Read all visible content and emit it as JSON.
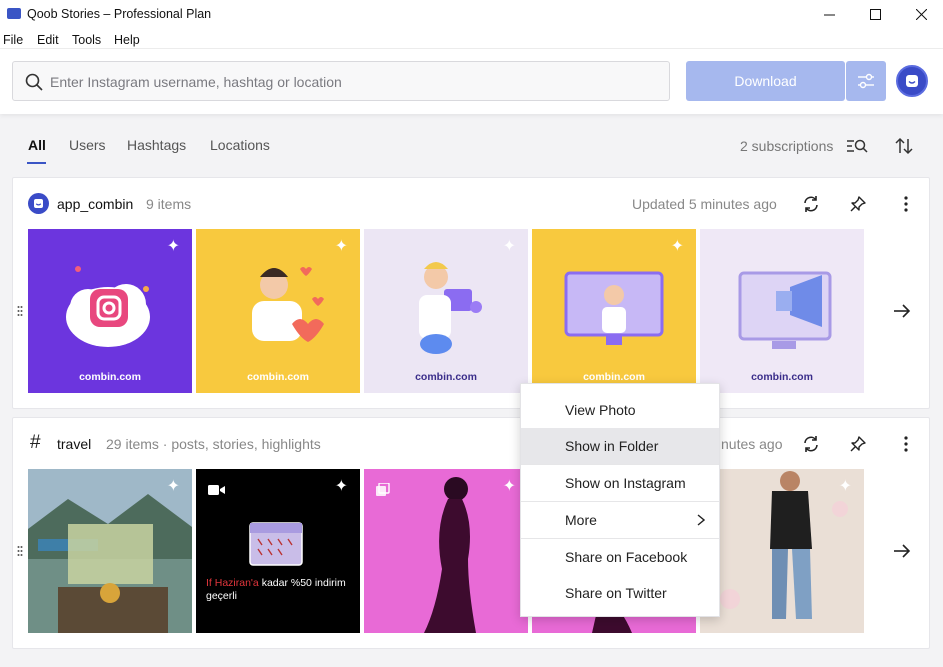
{
  "window": {
    "title": "Qoob Stories – Professional Plan"
  },
  "menu": [
    "File",
    "Edit",
    "Tools",
    "Help"
  ],
  "search": {
    "placeholder": "Enter Instagram username, hashtag or location"
  },
  "toolbar": {
    "download_label": "Download"
  },
  "tabs": [
    "All",
    "Users",
    "Hashtags",
    "Locations"
  ],
  "subscriptions_label": "2 subscriptions",
  "cards": [
    {
      "name": "app_combin",
      "count": "9 items",
      "updated": "Updated 5 minutes ago",
      "thumbs": [
        {
          "brand": "combin.com",
          "bg": "#6c35de"
        },
        {
          "brand": "combin.com",
          "bg": "#f8c93e"
        },
        {
          "brand": "combin.com",
          "bg": "#ece6f4"
        },
        {
          "brand": "combin.com",
          "bg": "#f8c93e"
        },
        {
          "brand": "combin.com",
          "bg": "#efe8f6"
        }
      ]
    },
    {
      "name": "travel",
      "count": "29 items · posts, stories, highlights",
      "updated": "nutes ago",
      "thumbs": [
        {
          "brand": "",
          "bg": "#5a7a6a"
        },
        {
          "brand": "",
          "bg": "#000000",
          "text1": "If Haziran'a",
          "text2": "kadar %50 indirim",
          "text3": "geçerli"
        },
        {
          "brand": "",
          "bg": "#e86ad6"
        },
        {
          "brand": "",
          "bg": "#e86ad6"
        },
        {
          "brand": "",
          "bg": "#e9ddd6"
        }
      ]
    }
  ],
  "context_menu": {
    "items": [
      "View Photo",
      "Show in Folder",
      "Show on Instagram",
      "More",
      "Share on Facebook",
      "Share on Twitter"
    ],
    "highlighted": "Show in Folder"
  },
  "colors": {
    "accent": "#3a55c5",
    "button": "#a6b8ee"
  }
}
